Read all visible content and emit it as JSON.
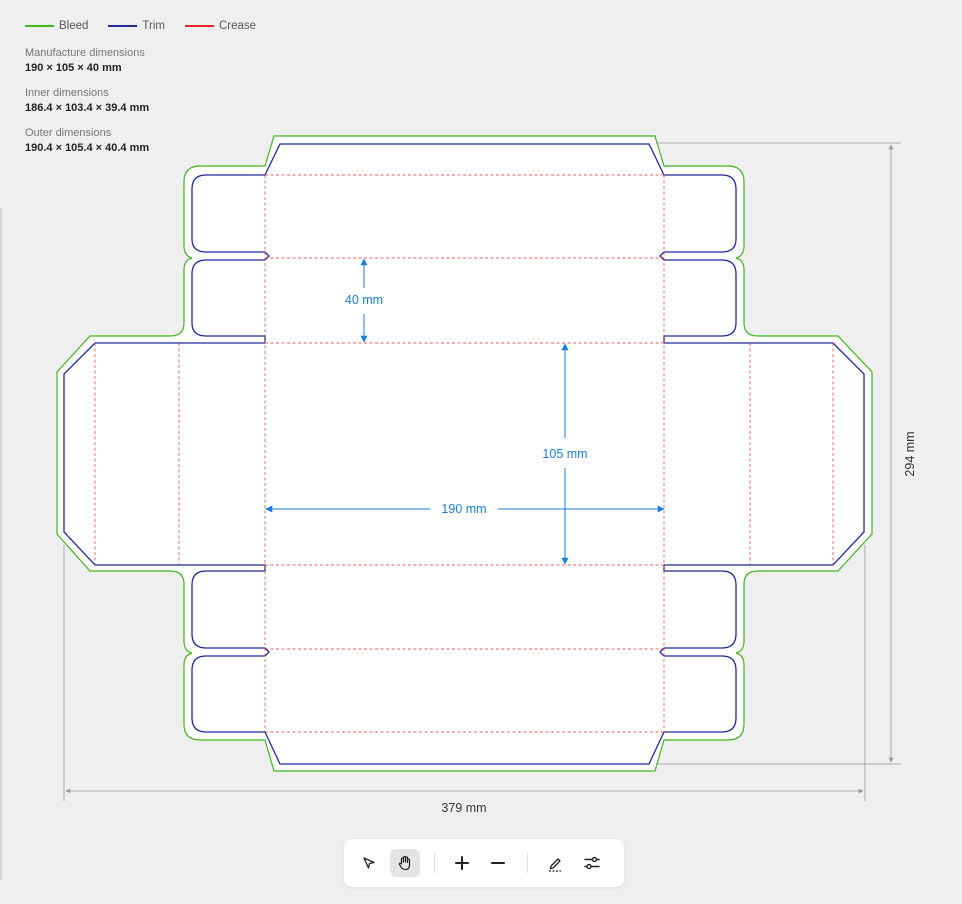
{
  "legend": {
    "bleed_label": "Bleed",
    "trim_label": "Trim",
    "crease_label": "Crease",
    "bleed_color": "#3db81f",
    "trim_color": "#1f2a9c",
    "crease_color": "#e8262b"
  },
  "dimensions": {
    "manufacture_label": "Manufacture dimensions",
    "manufacture_value": "190 × 105 × 40 mm",
    "inner_label": "Inner dimensions",
    "inner_value": "186.4 × 103.4 × 39.4 mm",
    "outer_label": "Outer dimensions",
    "outer_value": "190.4 × 105.4 × 40.4 mm"
  },
  "annotations": {
    "depth": "40 mm",
    "width": "105 mm",
    "length": "190 mm",
    "total_height": "294 mm",
    "total_width": "379 mm",
    "annotation_color": "#1a7ee6"
  },
  "toolbar": {
    "tools": [
      "select-arrow-icon",
      "hand-pan-icon",
      "zoom-in-icon",
      "zoom-out-icon",
      "pen-edit-icon",
      "settings-sliders-icon"
    ],
    "active_tool": "hand-pan-icon"
  }
}
